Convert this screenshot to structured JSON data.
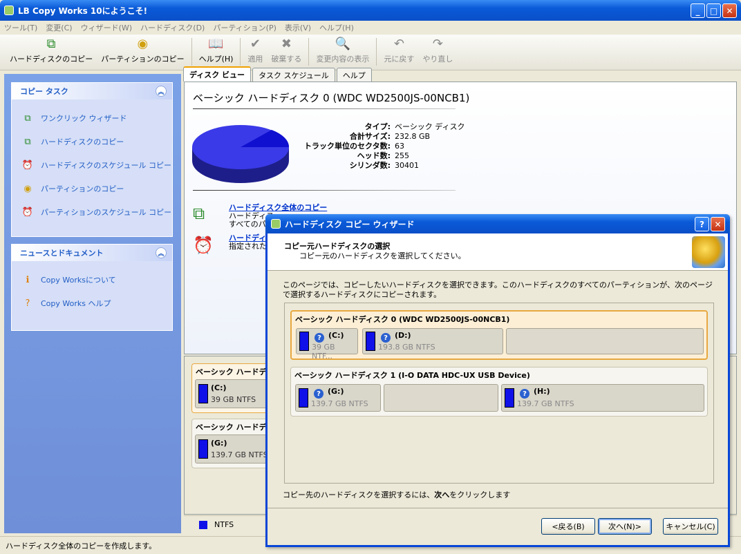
{
  "window": {
    "title": "LB Copy Works 10にようこそ!",
    "min": "_",
    "max": "□",
    "close": "✕"
  },
  "menu": [
    "ツール(T)",
    "変更(C)",
    "ウィザード(W)",
    "ハードディスク(D)",
    "パーティション(P)",
    "表示(V)",
    "ヘルプ(H)"
  ],
  "toolbar": {
    "disk_copy": "ハードディスクのコピー",
    "partition_copy": "パーティションのコピー",
    "help": "ヘルプ(H)",
    "apply": "適用",
    "discard": "破棄する",
    "show_changes": "変更内容の表示",
    "undo": "元に戻す",
    "redo": "やり直し"
  },
  "left": {
    "copy_tasks": {
      "title": "コピー タスク",
      "items": [
        "ワンクリック ウィザード",
        "ハードディスクのコピー",
        "ハードディスクのスケジュール コピー",
        "パーティションのコピー",
        "パーティションのスケジュール コピー"
      ]
    },
    "news": {
      "title": "ニュースとドキュメント",
      "items": [
        "Copy Worksについて",
        "Copy Works ヘルプ"
      ]
    }
  },
  "tabs": [
    "ディスク ビュー",
    "タスク スケジュール",
    "ヘルプ"
  ],
  "main": {
    "disk_title": "ベーシック ハードディスク 0 (WDC WD2500JS-00NCB1)",
    "props": [
      {
        "k": "タイプ:",
        "v": "ベーシック ディスク"
      },
      {
        "k": "合計サイズ:",
        "v": "232.8 GB"
      },
      {
        "k": "トラック単位のセクタ数:",
        "v": "63"
      },
      {
        "k": "ヘッド数:",
        "v": "255"
      },
      {
        "k": "シリンダ数:",
        "v": "30401"
      }
    ],
    "link1": "ハードディスク全体のコピー",
    "link1_desc1": "ハードディス",
    "link1_desc2": "すべてのパ",
    "link2": "ハードディ",
    "link2_desc": "指定された"
  },
  "lower": {
    "disk0_title": "ベーシック ハードデ",
    "disk0_part": {
      "label": "(C:)",
      "sub": "39 GB NTFS"
    },
    "disk1_title": "ベーシック ハードディ",
    "disk1_part": {
      "label": "(G:)",
      "sub": "139.7 GB NTFS"
    }
  },
  "legend": {
    "ntfs": "NTFS"
  },
  "status": "ハードディスク全体のコピーを作成します。",
  "dialog": {
    "title": "ハードディスク コピー ウィザード",
    "help": "?",
    "close": "✕",
    "header_title": "コピー元ハードディスクの選択",
    "header_sub": "コピー元のハードディスクを選択してください。",
    "desc": "このページでは、コピーしたいハードディスクを選択できます。このハードディスクのすべてのパーティションが、次のページで選択するハードディスクにコピーされます。",
    "disks": [
      {
        "title": "ベーシック ハードディスク 0 (WDC WD2500JS-00NCB1)",
        "parts": [
          {
            "label": "(C:)",
            "sub": "39 GB NTF..."
          },
          {
            "label": "(D:)",
            "sub": "193.8 GB NTFS"
          }
        ]
      },
      {
        "title": "ベーシック ハードディスク 1 (I-O DATA HDC-UX USB Device)",
        "parts": [
          {
            "label": "(G:)",
            "sub": "139.7 GB NTFS"
          },
          {
            "label": "(H:)",
            "sub": "139.7 GB NTFS"
          }
        ]
      }
    ],
    "footer_pre": "コピー先のハードディスクを選択するには、",
    "footer_bold": "次へ",
    "footer_post": "をクリックします",
    "back": "<戻る(B)",
    "next": "次へ(N)>",
    "cancel": "キャンセル(C)"
  },
  "colors": {
    "ntfs": "#1010e8",
    "accent": "#0a5ad8"
  }
}
